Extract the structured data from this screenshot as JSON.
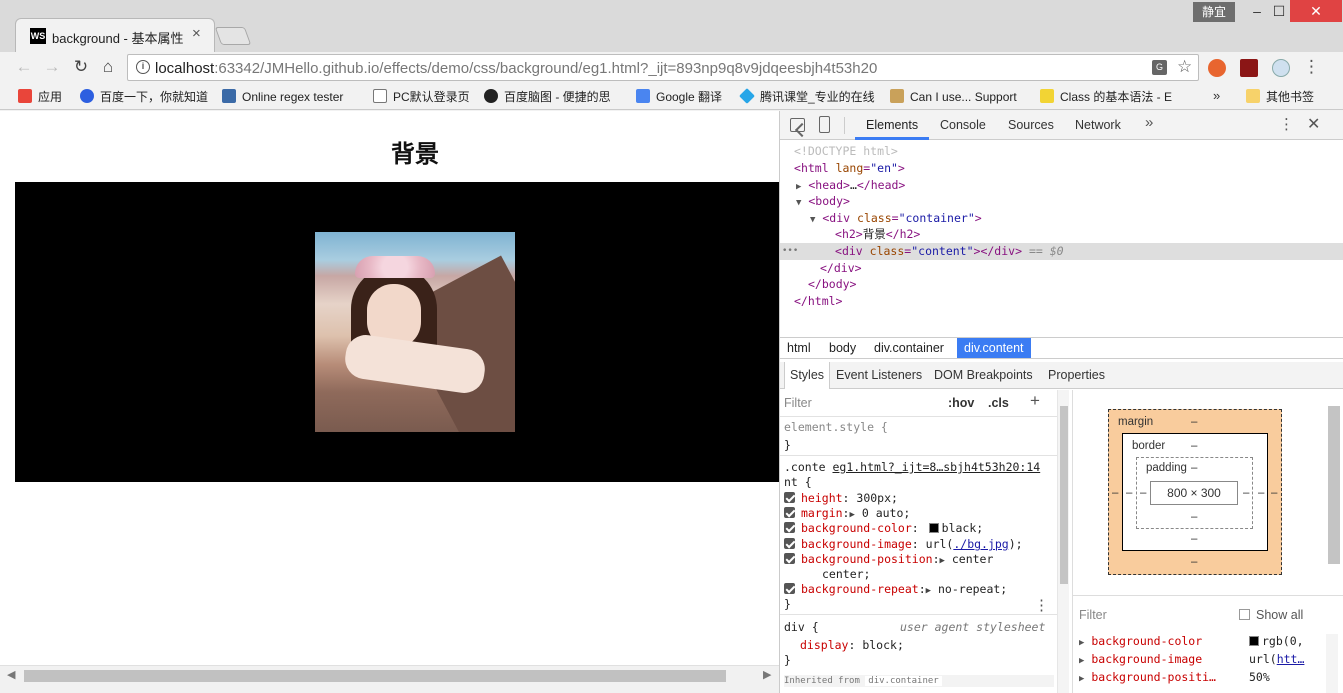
{
  "window": {
    "profile": "静宜",
    "minimize": "–",
    "maximize": "☐",
    "close": "✕"
  },
  "tab": {
    "favicon": "WS",
    "title": "background - 基本属性",
    "close": "×"
  },
  "toolbar": {
    "back": "←",
    "forward": "→",
    "reload": "↻",
    "home": "⌂",
    "url_host": "localhost",
    "url_path": ":63342/JMHello.github.io/effects/demo/css/background/eg1.html?_ijt=893np9q8v9jdqeesbjh4t53h20",
    "star": "☆",
    "menu": "⋮"
  },
  "bookmarks": {
    "items": [
      {
        "label": "应用",
        "icon": "apps-icon",
        "color": "#e9453a"
      },
      {
        "label": "百度一下，你就知道",
        "icon": "baidu-icon",
        "color": "#2d5fe0"
      },
      {
        "label": "Online regex tester",
        "icon": "regex-icon",
        "color": "#3b6aa7"
      },
      {
        "label": "PC默认登录页",
        "icon": "page-icon",
        "color": "#ffffff"
      },
      {
        "label": "百度脑图 - 便捷的思",
        "icon": "naotu-icon",
        "color": "#222222"
      },
      {
        "label": "Google 翻译",
        "icon": "google-translate-icon",
        "color": "#4a85f0"
      },
      {
        "label": "腾讯课堂_专业的在线",
        "icon": "tencent-icon",
        "color": "#27a6e8"
      },
      {
        "label": "Can I use... Support",
        "icon": "caniuse-icon",
        "color": "#c9a15a"
      },
      {
        "label": "Class 的基本语法 - E",
        "icon": "es-icon",
        "color": "#f2d434"
      }
    ],
    "more": "»",
    "other": "其他书签"
  },
  "page": {
    "heading": "背景"
  },
  "devtools": {
    "tabs": [
      "Elements",
      "Console",
      "Sources",
      "Network"
    ],
    "more": "»",
    "dom": {
      "doctype": "<!DOCTYPE html>",
      "html_open": "html",
      "html_lang_attr": "lang",
      "html_lang_val": "\"en\"",
      "head": "head",
      "head_ellipsis": "…",
      "body": "body",
      "div": "div",
      "class_attr": "class",
      "container_val": "\"container\"",
      "h2": "h2",
      "h2_text": "背景",
      "content_val": "\"content\"",
      "selected_marker": "== $0",
      "gutter_dots": "•••"
    },
    "breadcrumbs": [
      "html",
      "body",
      "div.container",
      "div.content"
    ],
    "sub_tabs": [
      "Styles",
      "Event Listeners",
      "DOM Breakpoints",
      "Properties"
    ],
    "styles": {
      "filter": "Filter",
      "hov": ":hov",
      "cls": ".cls",
      "add": "+",
      "element_style": "element.style {",
      "close_brace": "}",
      "rule_selector_a": ".conte",
      "rule_source": "eg1.html?_ijt=8…sbjh4t53h20:14",
      "rule_selector_b": "nt {",
      "props": [
        {
          "name": "height",
          "value": "300px;"
        },
        {
          "name": "margin",
          "value": "0 auto;"
        },
        {
          "name": "background-color",
          "value": "black;"
        },
        {
          "name": "background-image",
          "value_prefix": "url(",
          "value_link": "./bg.jpg",
          "value_suffix": ");"
        },
        {
          "name": "background-position",
          "value": "center",
          "value2": "center;"
        },
        {
          "name": "background-repeat",
          "value": "no-repeat;"
        }
      ],
      "ua_selector": "div {",
      "ua_source": "user agent stylesheet",
      "ua_prop": "display",
      "ua_value": "block;",
      "inherited": "Inherited from",
      "inherited_from": "div.container"
    },
    "box_model": {
      "margin": "margin",
      "border": "border",
      "padding": "padding",
      "dash": "–",
      "content": "800 × 300"
    },
    "computed": {
      "filter": "Filter",
      "show_all": "Show all",
      "rows": [
        {
          "name": "background-color",
          "value": "rgb(0,"
        },
        {
          "name": "background-image",
          "value_prefix": "url(",
          "value_link": "htt…"
        },
        {
          "name": "background-positi…",
          "value": "50%"
        }
      ]
    }
  }
}
